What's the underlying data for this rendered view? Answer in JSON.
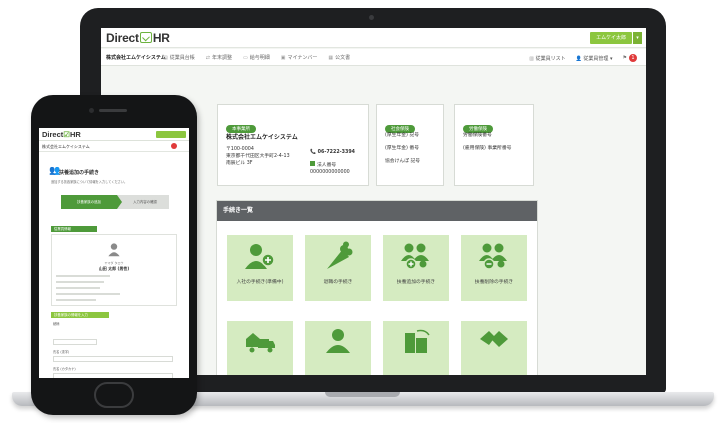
{
  "desktop": {
    "app_logo_left": "Direct",
    "app_logo_right": "HR",
    "company_button": "エムケイ太郎",
    "company_caret": "▾",
    "company_name": "株式会社エムケイシステム",
    "nav": [
      {
        "icon": "▤",
        "label": "従業員台帳"
      },
      {
        "icon": "⇄",
        "label": "年末調整"
      },
      {
        "icon": "▭",
        "label": "給与明細"
      },
      {
        "icon": "▣",
        "label": "マイナンバー"
      },
      {
        "icon": "▦",
        "label": "公文書"
      }
    ],
    "employee_list": "従業員リスト",
    "admin_menu": "従業員管理 ▾",
    "notification_count": "1",
    "head_office": {
      "pill": "本事業所",
      "name": "株式会社エムケイシステム",
      "zip": "〒100-0004",
      "address_1": "東京都千代田区大手町2-4-13",
      "address_2": "南辰ビル 3F",
      "phone": "06-7222-3394",
      "corp_label": "法人番号",
      "corp_number": "0000000000000"
    },
    "social_insurance": {
      "pill": "社会保険",
      "lines": [
        "(厚生年金) 記号",
        "(厚生年金) 番号",
        "協会けんぽ 記号"
      ]
    },
    "labor_insurance": {
      "pill": "労働保険",
      "lines": [
        "労働保険番号",
        "(雇用保険) 事業所番号"
      ]
    },
    "procedures_title": "手続き一覧",
    "tiles": [
      {
        "icon": "person-add-icon",
        "label": "入社の手続き(準備中)"
      },
      {
        "icon": "bouquet-icon",
        "label": "退職の手続き"
      },
      {
        "icon": "family-add-icon",
        "label": "扶養追加の手続き"
      },
      {
        "icon": "family-remove-icon",
        "label": "扶養削除の手続き"
      },
      {
        "icon": "moving-truck-icon",
        "label": ""
      },
      {
        "icon": "person-icon",
        "label": ""
      },
      {
        "icon": "building-icon",
        "label": ""
      },
      {
        "icon": "handshake-icon",
        "label": ""
      }
    ]
  },
  "mobile": {
    "logo_left": "Direct",
    "logo_right": "HR",
    "company_name": "株式会社エムケイシステム",
    "page_title": "扶養追加の手続き",
    "page_subtitle": "追加する扶養家族について情報を入力してください。",
    "step_1": "扶養家族の追加",
    "step_2": "入力内容の確認",
    "section_1": "従業員情報",
    "employee_kana": "ヤマダ タロウ",
    "employee_name": "山田 太郎 (男性)",
    "section_2": "扶養家族の情報を入力",
    "field_labels": [
      "続柄",
      "氏名 (漢字)",
      "氏名 (カタカナ)"
    ]
  },
  "colors": {
    "brand_green": "#8cc63f",
    "dark_green": "#4e9a3a",
    "tile_green": "#d5ebc1",
    "header_gray": "#5f6265",
    "alert_red": "#e03a3a"
  }
}
